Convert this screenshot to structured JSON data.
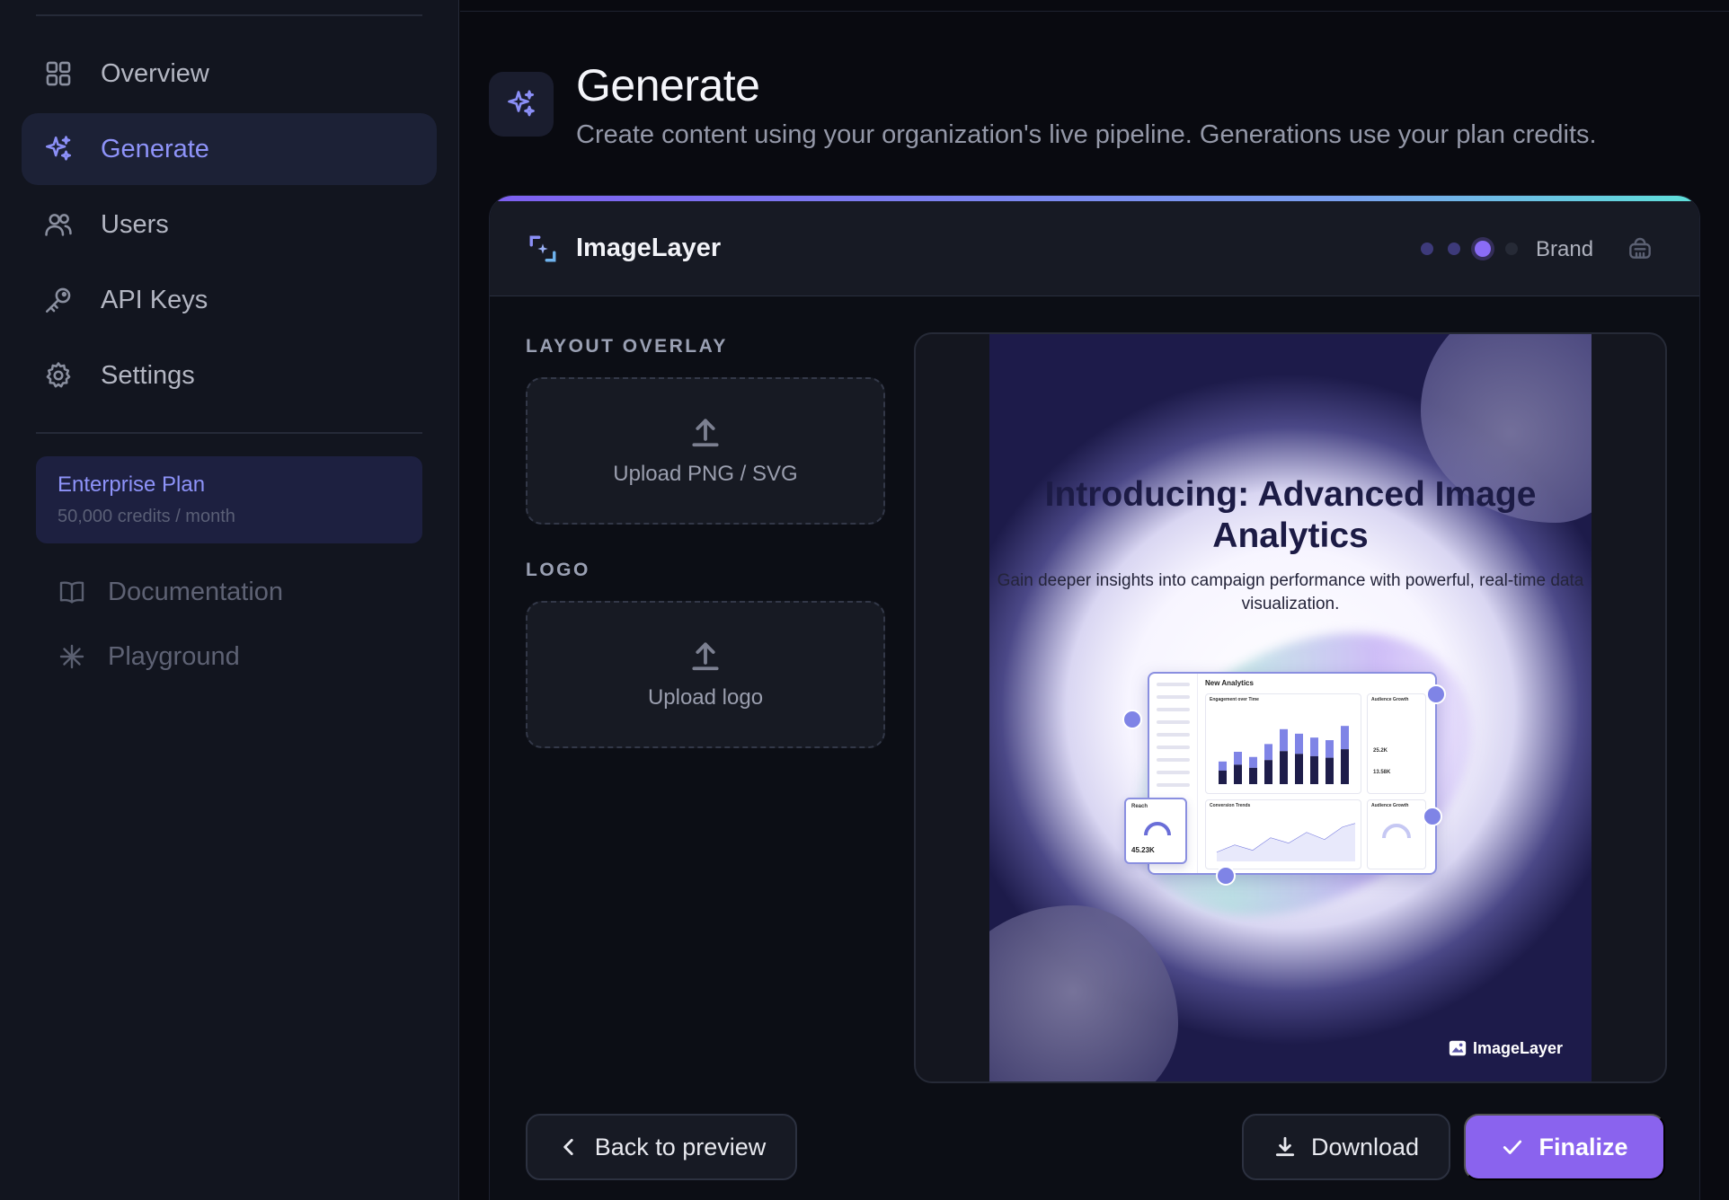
{
  "nav": {
    "items": [
      {
        "label": "Overview",
        "icon": "grid-icon"
      },
      {
        "label": "Generate",
        "icon": "sparkles-icon",
        "active": true
      },
      {
        "label": "Users",
        "icon": "users-icon"
      },
      {
        "label": "API Keys",
        "icon": "key-icon"
      },
      {
        "label": "Settings",
        "icon": "gear-icon"
      }
    ]
  },
  "plan": {
    "name": "Enterprise Plan",
    "credits": "50,000 credits / month"
  },
  "external": [
    {
      "label": "Documentation",
      "icon": "book-icon"
    },
    {
      "label": "Playground",
      "icon": "asterisk-icon"
    }
  ],
  "header": {
    "title": "Generate",
    "subtitle": "Create content using your organization's live pipeline. Generations use your plan credits."
  },
  "card": {
    "brand": "ImageLayer",
    "step_label": "Brand",
    "steps_total": 4,
    "steps_current": 3,
    "layout_overlay": {
      "label": "LAYOUT OVERLAY",
      "upload": "Upload PNG / SVG"
    },
    "logo": {
      "label": "LOGO",
      "upload": "Upload logo"
    },
    "preview": {
      "title": "Introducing: Advanced Image Analytics",
      "subtitle": "Gain deeper insights into campaign performance with powerful, real-time data visualization.",
      "brand": "ImageLayer",
      "dashboard": {
        "title": "New Analytics",
        "panel1": "Engagement over Time",
        "panel2": "Audience Growth",
        "panel3": "Conversion Trends",
        "panel4": "Audience Growth",
        "reach_label": "Reach",
        "reach_value": "45.23K",
        "stat1": "25.2K",
        "stat2": "13.58K",
        "bars": [
          0.35,
          0.5,
          0.42,
          0.62,
          0.85,
          0.78,
          0.72,
          0.68,
          0.9
        ]
      }
    },
    "buttons": {
      "back": "Back to preview",
      "download": "Download",
      "finalize": "Finalize"
    }
  },
  "colors": {
    "accent": "#8a63ee",
    "nav_active": "#8e93f9",
    "sidebar_bg": "#12151f",
    "page_bg": "#090a10"
  }
}
